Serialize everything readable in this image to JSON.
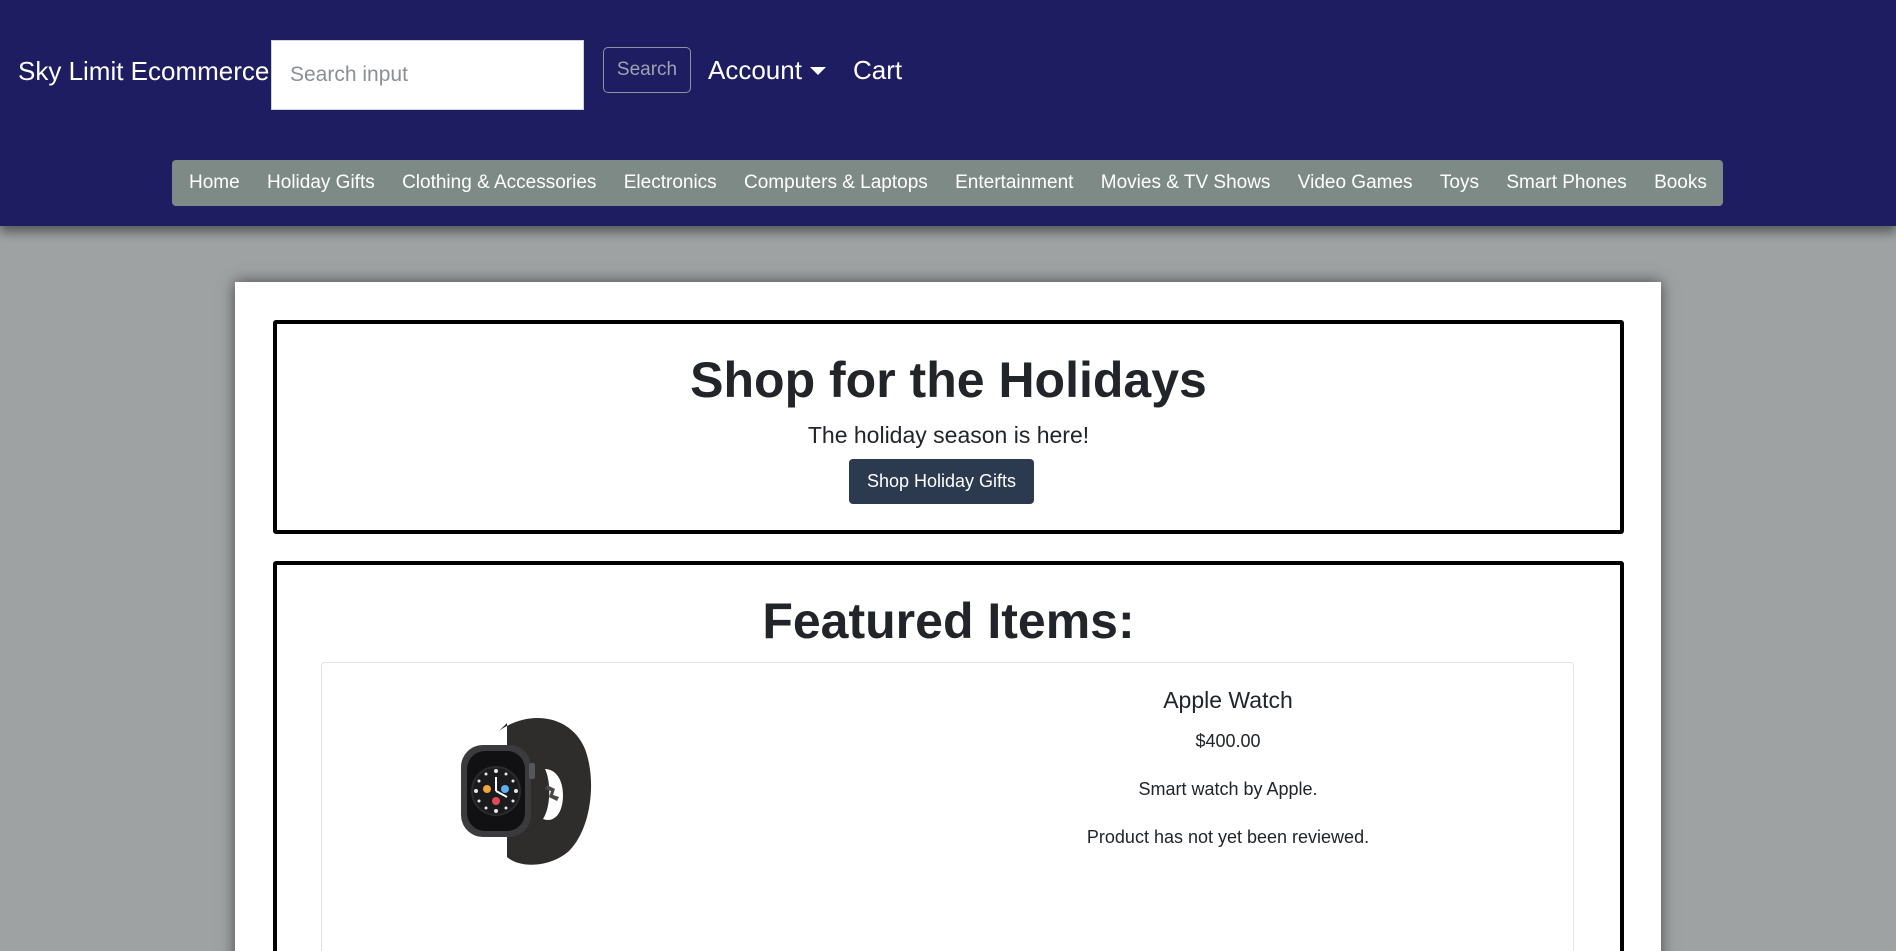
{
  "header": {
    "brand": "Sky Limit Ecommerce",
    "search": {
      "placeholder": "Search input",
      "value": "",
      "button_label": "Search"
    },
    "account_label": "Account",
    "cart_label": "Cart",
    "colors": {
      "background": "#1f1d61",
      "category_bar": "#7e8a86"
    }
  },
  "categories": [
    "Home",
    "Holiday Gifts",
    "Clothing & Accessories",
    "Electronics",
    "Computers & Laptops",
    "Entertainment",
    "Movies & TV Shows",
    "Video Games",
    "Toys",
    "Smart Phones",
    "Books"
  ],
  "hero": {
    "title": "Shop for the Holidays",
    "subtitle": "The holiday season is here!",
    "button_label": "Shop Holiday Gifts",
    "button_color": "#2b3a4e"
  },
  "featured": {
    "title": "Featured Items:",
    "items": [
      {
        "name": "Apple Watch",
        "price": "$400.00",
        "description": "Smart watch by Apple.",
        "review_status": "Product has not yet been reviewed.",
        "image_icon": "apple-watch-image"
      }
    ]
  }
}
